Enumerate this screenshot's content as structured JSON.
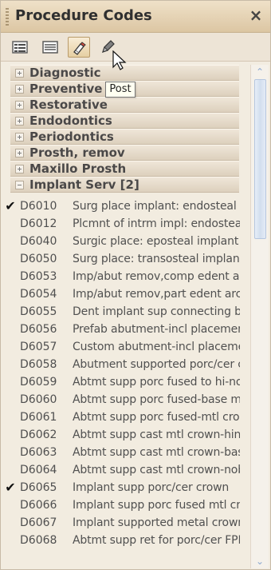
{
  "panel": {
    "title": "Procedure Codes",
    "close_label": "×"
  },
  "toolbar": {
    "tooltip": "Post"
  },
  "categories": [
    {
      "label": "Diagnostic",
      "expanded": false
    },
    {
      "label": "Preventive",
      "expanded": false
    },
    {
      "label": "Restorative",
      "expanded": false
    },
    {
      "label": "Endodontics",
      "expanded": false
    },
    {
      "label": "Periodontics",
      "expanded": false
    },
    {
      "label": "Prosth, remov",
      "expanded": false
    },
    {
      "label": "Maxillo Prosth",
      "expanded": false
    },
    {
      "label": "Implant Serv [2]",
      "expanded": true
    }
  ],
  "items": [
    {
      "checked": "✔",
      "code": "D6010",
      "description": "Surg place implant: endosteal"
    },
    {
      "checked": "",
      "code": "D6012",
      "description": "Plcmnt of intrm impl: endosteal"
    },
    {
      "checked": "",
      "code": "D6040",
      "description": "Surgic place: eposteal implant"
    },
    {
      "checked": "",
      "code": "D6050",
      "description": "Surg place: transosteal implant"
    },
    {
      "checked": "",
      "code": "D6053",
      "description": "Imp/abut remov,comp edent arch"
    },
    {
      "checked": "",
      "code": "D6054",
      "description": "Imp/abut remov,part edent arch"
    },
    {
      "checked": "",
      "code": "D6055",
      "description": "Dent implant sup connecting bar"
    },
    {
      "checked": "",
      "code": "D6056",
      "description": "Prefab abutment-incl placement"
    },
    {
      "checked": "",
      "code": "D6057",
      "description": "Custom abutment-incl placement"
    },
    {
      "checked": "",
      "code": "D6058",
      "description": "Abutment supported porc/cer crn"
    },
    {
      "checked": "",
      "code": "D6059",
      "description": "Abtmt supp porc fused to hi-nob"
    },
    {
      "checked": "",
      "code": "D6060",
      "description": "Abtmt supp porc fused-base metl"
    },
    {
      "checked": "",
      "code": "D6061",
      "description": "Abtmt supp porc fused-mtl crown"
    },
    {
      "checked": "",
      "code": "D6062",
      "description": "Abtmt supp cast mtl crown-hinob"
    },
    {
      "checked": "",
      "code": "D6063",
      "description": "Abtmt supp cast mtl crown-base"
    },
    {
      "checked": "",
      "code": "D6064",
      "description": "Abtmt supp cast mtl crown-noble"
    },
    {
      "checked": "✔",
      "code": "D6065",
      "description": "Implant supp porc/cer crown"
    },
    {
      "checked": "",
      "code": "D6066",
      "description": "Implant supp porc fused mtl crn"
    },
    {
      "checked": "",
      "code": "D6067",
      "description": "Implant supported metal crown"
    },
    {
      "checked": "",
      "code": "D6068",
      "description": "Abtmt supp ret for porc/cer FPD"
    }
  ],
  "colors": {
    "panel_bg": "#ece5d8",
    "header_bg": "#dcc6a3",
    "accent": "#8da9d1"
  }
}
